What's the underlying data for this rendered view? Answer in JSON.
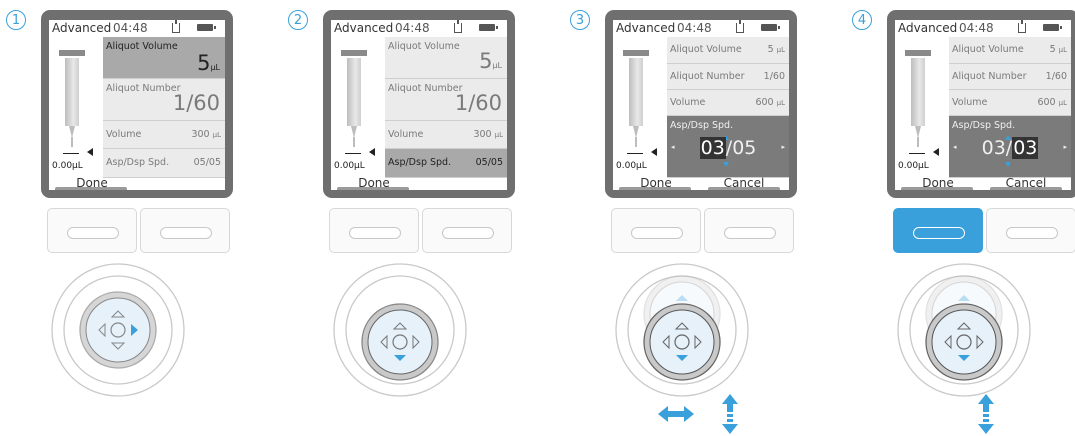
{
  "steps": [
    {
      "number": "1",
      "header": {
        "title": "Advanced",
        "time": "04:48"
      },
      "syringe": {
        "volume": "0.00µL"
      },
      "rows": [
        {
          "label": "Aliquot Volume",
          "value": "5",
          "unit": "µL"
        },
        {
          "label": "Aliquot Number",
          "value": "1/60"
        },
        {
          "label": "Volume",
          "value": "300",
          "unit": "µL"
        },
        {
          "label": "Asp/Dsp Spd.",
          "value": "05/05"
        }
      ],
      "softkeys": {
        "left": "Done",
        "right": ""
      },
      "dial_direction": "right"
    },
    {
      "number": "2",
      "header": {
        "title": "Advanced",
        "time": "04:48"
      },
      "syringe": {
        "volume": "0.00µL"
      },
      "rows": [
        {
          "label": "Aliquot Volume",
          "value": "5",
          "unit": "µL"
        },
        {
          "label": "Aliquot Number",
          "value": "1/60"
        },
        {
          "label": "Volume",
          "value": "300",
          "unit": "µL"
        },
        {
          "label": "Asp/Dsp Spd.",
          "value": "05/05"
        }
      ],
      "softkeys": {
        "left": "Done",
        "right": ""
      },
      "dial_direction": "down"
    },
    {
      "number": "3",
      "header": {
        "title": "Advanced",
        "time": "04:48"
      },
      "syringe": {
        "volume": "0.00µL"
      },
      "rows": [
        {
          "label": "Aliquot Volume",
          "value": "5",
          "unit": "µL"
        },
        {
          "label": "Aliquot Number",
          "value": "1/60"
        },
        {
          "label": "Volume",
          "value": "600",
          "unit": "µL"
        },
        {
          "label": "Asp/Dsp Spd.",
          "value_a": "03",
          "value_b": "/05"
        }
      ],
      "softkeys": {
        "left": "Done",
        "right": "Cancel"
      },
      "dial_direction": "down"
    },
    {
      "number": "4",
      "header": {
        "title": "Advanced",
        "time": "04:48"
      },
      "syringe": {
        "volume": "0.00µL"
      },
      "rows": [
        {
          "label": "Aliquot Volume",
          "value": "5",
          "unit": "µL"
        },
        {
          "label": "Aliquot Number",
          "value": "1/60"
        },
        {
          "label": "Volume",
          "value": "600",
          "unit": "µL"
        },
        {
          "label": "Asp/Dsp Spd.",
          "value_a": "03/",
          "value_b": "03"
        }
      ],
      "softkeys": {
        "left": "Done",
        "right": "Cancel"
      },
      "dial_direction": "down"
    }
  ],
  "colors": {
    "accent": "#3aa0db",
    "device": "#6f6f6f",
    "selected_row": "#a9a9a9",
    "editing_row": "#7b7b7b"
  },
  "icons": [
    "pipette-icon",
    "battery-icon",
    "dial-icon",
    "arrow-icon"
  ]
}
